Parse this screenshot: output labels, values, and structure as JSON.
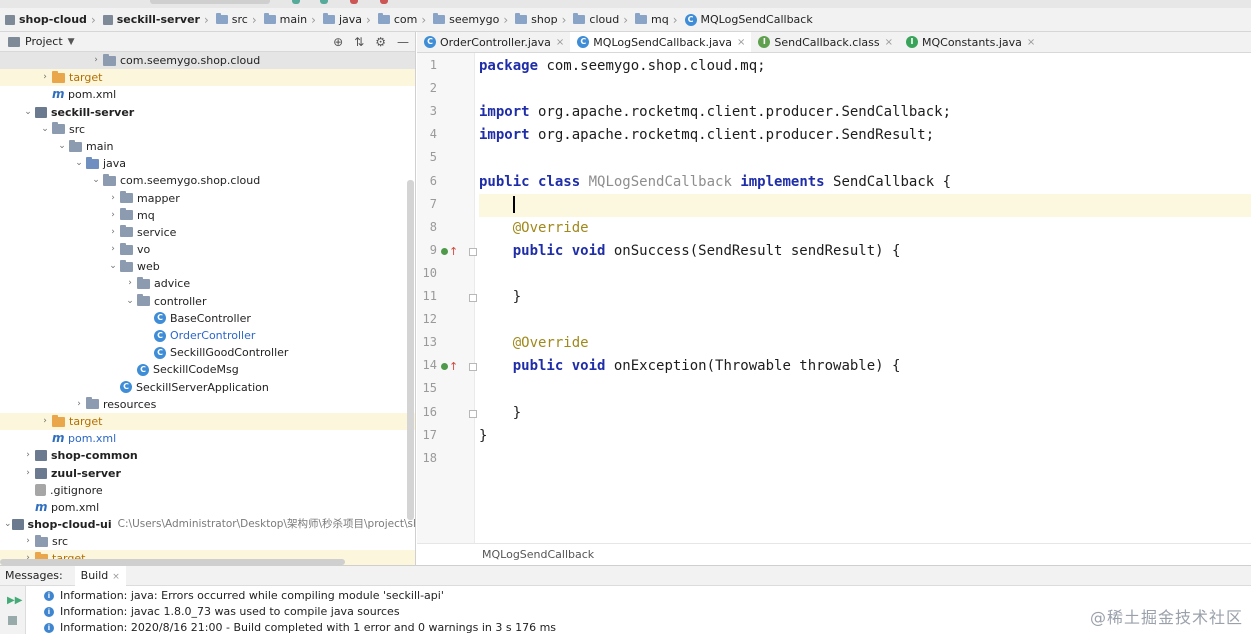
{
  "breadcrumb": [
    {
      "label": "shop-cloud",
      "icon": "module-icon",
      "bold": true
    },
    {
      "label": "seckill-server",
      "icon": "module-icon",
      "bold": true
    },
    {
      "label": "src",
      "icon": "folder-icon"
    },
    {
      "label": "main",
      "icon": "folder-icon"
    },
    {
      "label": "java",
      "icon": "folder-icon"
    },
    {
      "label": "com",
      "icon": "folder-icon"
    },
    {
      "label": "seemygo",
      "icon": "folder-icon"
    },
    {
      "label": "shop",
      "icon": "folder-icon"
    },
    {
      "label": "cloud",
      "icon": "folder-icon"
    },
    {
      "label": "mq",
      "icon": "folder-icon"
    },
    {
      "label": "MQLogSendCallback",
      "icon": "class-icon"
    }
  ],
  "project_panel": {
    "title": "Project",
    "tree": [
      {
        "label": "com.seemygo.shop.cloud",
        "depth": 5,
        "arrow": "right",
        "icon": "folder",
        "sel": true
      },
      {
        "label": "target",
        "depth": 2,
        "arrow": "right",
        "icon": "ofolder",
        "hl": true,
        "style": "orange"
      },
      {
        "label": "pom.xml",
        "depth": 2,
        "arrow": "",
        "icon": "maven"
      },
      {
        "label": "seckill-server",
        "depth": 1,
        "arrow": "down",
        "icon": "module",
        "style": "b"
      },
      {
        "label": "src",
        "depth": 2,
        "arrow": "down",
        "icon": "folder"
      },
      {
        "label": "main",
        "depth": 3,
        "arrow": "down",
        "icon": "folder"
      },
      {
        "label": "java",
        "depth": 4,
        "arrow": "down",
        "icon": "bfolder"
      },
      {
        "label": "com.seemygo.shop.cloud",
        "depth": 5,
        "arrow": "down",
        "icon": "folder"
      },
      {
        "label": "mapper",
        "depth": 6,
        "arrow": "right",
        "icon": "folder"
      },
      {
        "label": "mq",
        "depth": 6,
        "arrow": "right",
        "icon": "folder"
      },
      {
        "label": "service",
        "depth": 6,
        "arrow": "right",
        "icon": "folder"
      },
      {
        "label": "vo",
        "depth": 6,
        "arrow": "right",
        "icon": "folder"
      },
      {
        "label": "web",
        "depth": 6,
        "arrow": "down",
        "icon": "folder"
      },
      {
        "label": "advice",
        "depth": 7,
        "arrow": "right",
        "icon": "folder"
      },
      {
        "label": "controller",
        "depth": 7,
        "arrow": "down",
        "icon": "folder"
      },
      {
        "label": "BaseController",
        "depth": 8,
        "arrow": "",
        "icon": "cls"
      },
      {
        "label": "OrderController",
        "depth": 8,
        "arrow": "",
        "icon": "cls",
        "style": "blue"
      },
      {
        "label": "SeckillGoodController",
        "depth": 8,
        "arrow": "",
        "icon": "cls"
      },
      {
        "label": "SeckillCodeMsg",
        "depth": 7,
        "arrow": "",
        "icon": "cls"
      },
      {
        "label": "SeckillServerApplication",
        "depth": 6,
        "arrow": "",
        "icon": "cls"
      },
      {
        "label": "resources",
        "depth": 4,
        "arrow": "right",
        "icon": "folder"
      },
      {
        "label": "target",
        "depth": 2,
        "arrow": "right",
        "icon": "ofolder",
        "hl": true,
        "style": "orange"
      },
      {
        "label": "pom.xml",
        "depth": 2,
        "arrow": "",
        "icon": "maven",
        "style": "blue"
      },
      {
        "label": "shop-common",
        "depth": 1,
        "arrow": "right",
        "icon": "module",
        "style": "b"
      },
      {
        "label": "zuul-server",
        "depth": 1,
        "arrow": "right",
        "icon": "module",
        "style": "b"
      },
      {
        "label": ".gitignore",
        "depth": 1,
        "arrow": "",
        "icon": "git"
      },
      {
        "label": "pom.xml",
        "depth": 1,
        "arrow": "",
        "icon": "maven"
      },
      {
        "label": "shop-cloud-ui",
        "depth": 0,
        "arrow": "down",
        "icon": "module",
        "style": "b",
        "path": "C:\\Users\\Administrator\\Desktop\\架构师\\秒杀项目\\project\\sho"
      },
      {
        "label": "src",
        "depth": 1,
        "arrow": "right",
        "icon": "folder"
      },
      {
        "label": "target",
        "depth": 1,
        "arrow": "right",
        "icon": "ofolder",
        "hl": true,
        "style": "orange"
      }
    ]
  },
  "tabs": [
    {
      "label": "OrderController.java",
      "icon": "c",
      "active": false
    },
    {
      "label": "MQLogSendCallback.java",
      "icon": "c",
      "active": true
    },
    {
      "label": "SendCallback.class",
      "icon": "g",
      "active": false
    },
    {
      "label": "MQConstants.java",
      "icon": "i",
      "active": false
    }
  ],
  "editor": {
    "line_numbers": [
      "1",
      "2",
      "3",
      "4",
      "5",
      "6",
      "7",
      "8",
      "9",
      "10",
      "11",
      "12",
      "13",
      "14",
      "15",
      "16",
      "17",
      "18"
    ],
    "l1_kw": "package",
    "l1_rest": " com.seemygo.shop.cloud.mq;",
    "l3_kw": "import",
    "l3_rest": " org.apache.rocketmq.client.producer.SendCallback;",
    "l4_kw": "import",
    "l4_rest": " org.apache.rocketmq.client.producer.SendResult;",
    "l6_kw1": "public class",
    "l6_name": "MQLogSendCallback",
    "l6_kw2": "implements",
    "l6_rest": " SendCallback {",
    "l8_an": "@Override",
    "l9_kw": "public void",
    "l9_rest": " onSuccess(SendResult sendResult) {",
    "l11": "}",
    "l13_an": "@Override",
    "l14_kw": "public void",
    "l14_rest": " onException(Throwable throwable) {",
    "l16": "}",
    "l17": "}",
    "footer_breadcrumb": "MQLogSendCallback"
  },
  "messages": {
    "title": "Messages:",
    "tab": "Build",
    "rows": [
      "Information: java: Errors occurred while compiling module 'seckill-api'",
      "Information: javac 1.8.0_73 was used to compile java sources",
      "Information: 2020/8/16 21:00 - Build completed with 1 error and 0 warnings in 3 s 176 ms"
    ]
  },
  "watermark": "@稀土掘金技术社区",
  "colors": {
    "keyword": "#1f2ea8",
    "annotation": "#a0891b",
    "class_icon": "#3e8dd6",
    "target_folder": "#e9a64a"
  }
}
